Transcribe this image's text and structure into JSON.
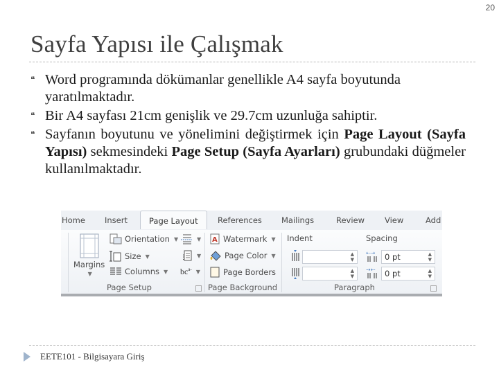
{
  "slide": {
    "page_number": "20",
    "title": "Sayfa Yapısı ile Çalışmak",
    "footer": "EETE101 - Bilgisayara Giriş"
  },
  "bullets": [
    {
      "text": "Word programında dökümanlar genellikle A4 sayfa boyutunda yaratılmaktadır."
    },
    {
      "text": "Bir A4 sayfası 21cm genişlik ve 29.7cm uzunluğa sahiptir."
    },
    {
      "part1": "Sayfanın boyutunu ve yönelimini değiştirmek için ",
      "bold1": "Page Layout (Sayfa Yapısı)",
      "part2": " sekmesindeki ",
      "bold2": "Page Setup (Sayfa Ayarları)",
      "part3": " grubundaki düğmeler kullanılmaktadır."
    }
  ],
  "ribbon": {
    "tabs": [
      "Home",
      "Insert",
      "Page Layout",
      "References",
      "Mailings",
      "Review",
      "View",
      "Add"
    ],
    "active_tab": "Page Layout",
    "page_setup": {
      "margins": "Margins",
      "orientation": "Orientation",
      "size": "Size",
      "columns": "Columns",
      "group_label": "Page Setup"
    },
    "page_background": {
      "watermark": "Watermark",
      "page_color": "Page Color",
      "page_borders": "Page Borders",
      "group_label": "Page Background"
    },
    "paragraph": {
      "indent_label": "Indent",
      "spacing_label": "Spacing",
      "indent_left": "",
      "indent_right": "",
      "spacing_before": "0 pt",
      "spacing_after": "0 pt",
      "group_label": "Paragraph"
    }
  }
}
